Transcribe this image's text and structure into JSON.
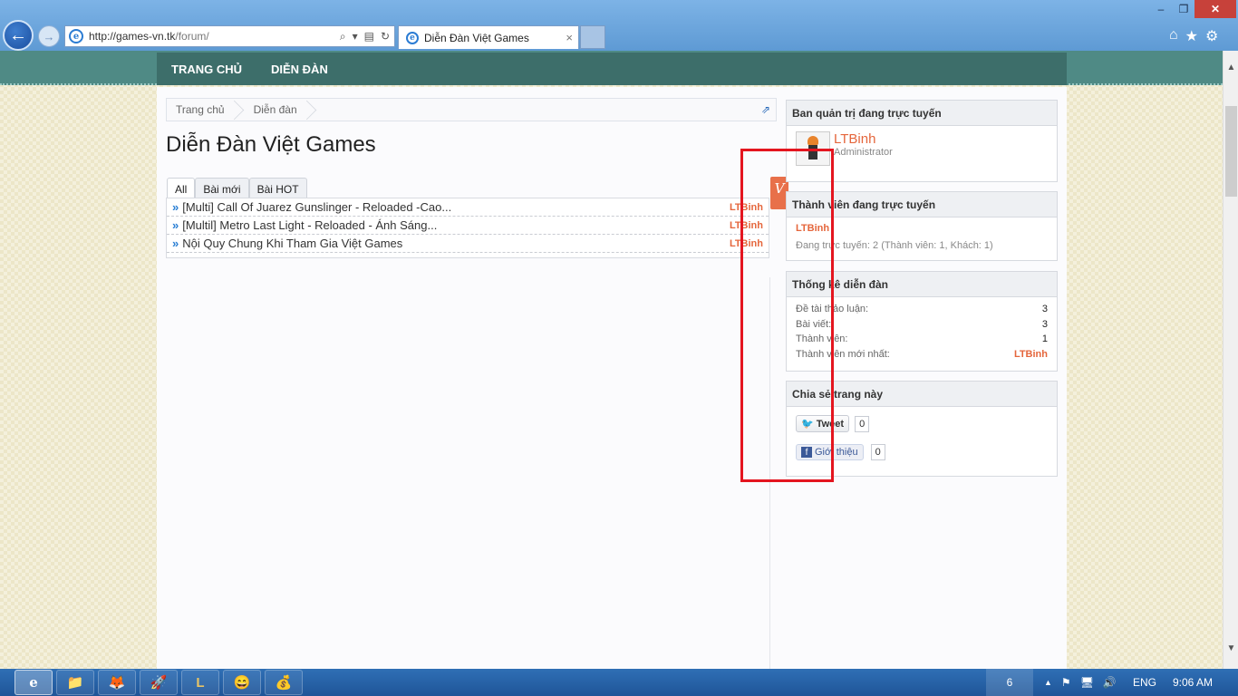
{
  "browser": {
    "url_host": "http://games-vn.tk",
    "url_path": "/forum/",
    "tab_title": "Diễn Đàn Việt Games",
    "tab_close": "×",
    "address_tools": [
      "⌕",
      "▾",
      "▤",
      "↻"
    ],
    "window_controls": {
      "minimize": "–",
      "maximize": "❐",
      "close": "✕"
    },
    "right_icons": [
      "⌂",
      "★",
      "⚙"
    ],
    "ie_glyph": "e"
  },
  "nav": {
    "items": [
      "TRANG CHỦ",
      "DIỄN ĐÀN"
    ]
  },
  "breadcrumb": {
    "items": [
      "Trang chủ",
      "Diễn đàn"
    ],
    "link_icon": "⇗"
  },
  "page": {
    "title": "Diễn Đàn Việt Games"
  },
  "tabs": [
    "All",
    "Bài mới",
    "Bài HOT"
  ],
  "threads": [
    {
      "title": "[Multi] Call Of Juarez Gunslinger - Reloaded -Cao...",
      "author": "LTBinh"
    },
    {
      "title": "[Multil] Metro Last Light - Reloaded - Ánh Sáng...",
      "author": "LTBinh"
    },
    {
      "title": "Nội Quy Chung Khi Tham Gia Việt Games",
      "author": "LTBinh"
    }
  ],
  "thread_arrow": "»",
  "side_tag": "V",
  "sidebar": {
    "staff": {
      "heading": "Ban quản trị đang trực tuyến",
      "name": "LTBinh",
      "role": "Administrator"
    },
    "online": {
      "heading": "Thành viên đang trực tuyến",
      "member": "LTBinh",
      "summary": "Đang trực tuyến: 2 (Thành viên: 1, Khách: 1)"
    },
    "stats": {
      "heading": "Thống kê diễn đàn",
      "rows": [
        {
          "label": "Đề tài thảo luận:",
          "value": "3"
        },
        {
          "label": "Bài viết:",
          "value": "3"
        },
        {
          "label": "Thành viên:",
          "value": "1"
        },
        {
          "label": "Thành viên mới nhất:",
          "value": "LTBinh"
        }
      ]
    },
    "share": {
      "heading": "Chia sẻ trang này",
      "tweet_label": "Tweet",
      "tweet_count": "0",
      "fb_label": "Giới thiệu",
      "fb_count": "0",
      "fb_glyph": "f",
      "tw_glyph": "🐦"
    }
  },
  "scrollbar": {
    "up": "▲",
    "down": "▼"
  },
  "taskbar": {
    "apps": [
      "e",
      "📁",
      "🦊",
      "🚀",
      "L",
      "😄",
      "💰"
    ],
    "people_count": "6",
    "tray_icons": [
      "▲",
      "⚑",
      "🖥",
      "🔊"
    ],
    "language": "ENG",
    "time": "9:06 AM"
  },
  "colors": {
    "accent_orange": "#e5663c",
    "nav_teal": "#3d6e6a",
    "annotation_red": "#e4151f"
  }
}
